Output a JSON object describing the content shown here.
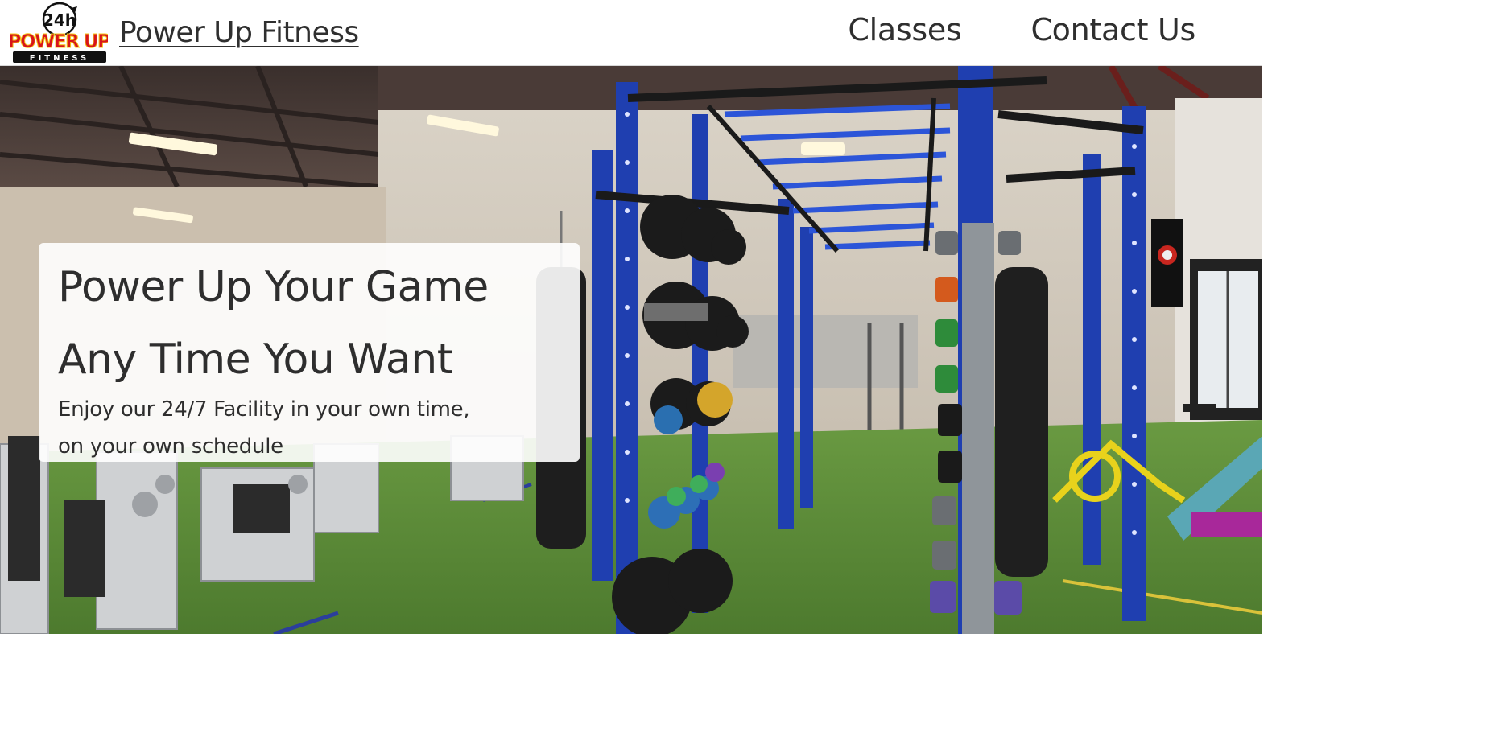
{
  "header": {
    "logo": {
      "badge_text": "24h",
      "main_text": "POWER UP",
      "sub_text": "FITNESS"
    },
    "brand_name": "Power Up Fitness",
    "nav": [
      {
        "label": "Classes"
      },
      {
        "label": "Contact Us"
      }
    ]
  },
  "hero": {
    "title_line1": "Power Up Your Game",
    "title_line2": "Any Time You Want",
    "subtitle_line1": "Enjoy our 24/7 Facility in your own time,",
    "subtitle_line2": "on your own schedule"
  },
  "colors": {
    "text": "#2f2f2f",
    "logo_red": "#d8141c",
    "logo_yellow": "#f5c518",
    "turf_green": "#5f8a3a",
    "rack_blue": "#1f3fb0"
  }
}
